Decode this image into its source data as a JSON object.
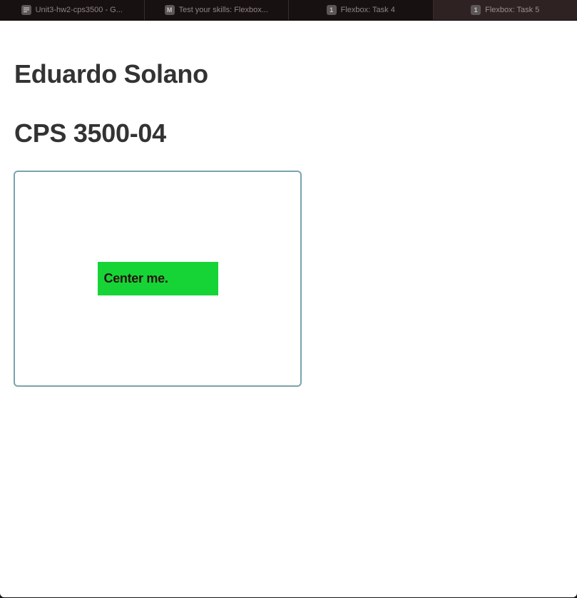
{
  "browser": {
    "tabs": [
      {
        "label": "Unit3-hw2-cps3500 - G...",
        "icon": "document-icon",
        "active": false
      },
      {
        "label": "Test your skills: Flexbox...",
        "icon": "M",
        "active": false
      },
      {
        "label": "Flexbox: Task 4",
        "icon": "1",
        "active": false
      },
      {
        "label": "Flexbox: Task 5",
        "icon": "1",
        "active": true
      }
    ]
  },
  "page": {
    "name_heading": "Eduardo Solano",
    "course_heading": "CPS 3500-04",
    "center_text": "Center me."
  },
  "colors": {
    "box_border": "#7aa3ae",
    "child_background": "#16d436",
    "heading_text": "#333333"
  }
}
